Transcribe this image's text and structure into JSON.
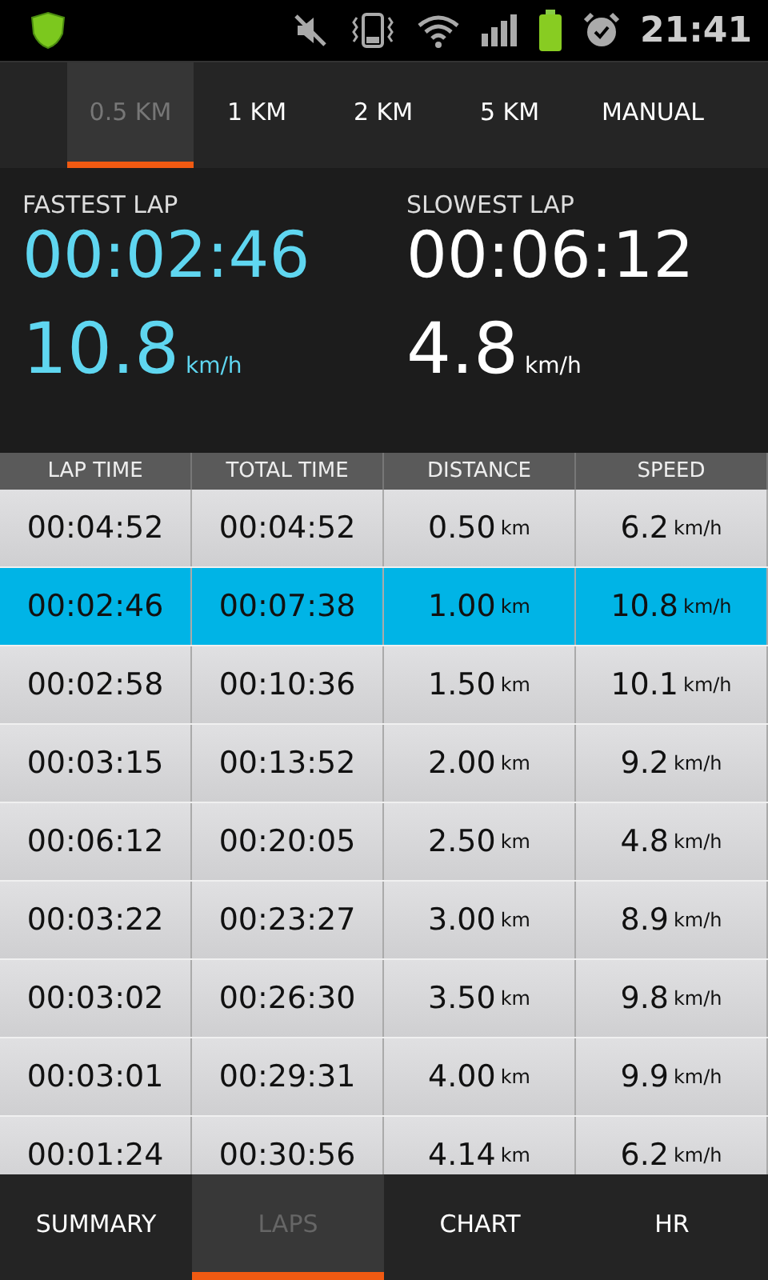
{
  "status_bar": {
    "time": "21:41"
  },
  "distance_tabs": [
    {
      "label": "0.5 KM",
      "selected": true
    },
    {
      "label": "1 KM",
      "selected": false
    },
    {
      "label": "2 KM",
      "selected": false
    },
    {
      "label": "5 KM",
      "selected": false
    },
    {
      "label": "MANUAL",
      "selected": false
    }
  ],
  "summary": [
    {
      "label": "FASTEST LAP",
      "time": "00:02:46",
      "speed": "10.8",
      "unit": "km/h",
      "kind": "fast"
    },
    {
      "label": "SLOWEST LAP",
      "time": "00:06:12",
      "speed": "4.8",
      "unit": "km/h",
      "kind": "slow"
    }
  ],
  "table": {
    "columns": [
      "LAP TIME",
      "TOTAL TIME",
      "DISTANCE",
      "SPEED"
    ],
    "rows": [
      {
        "lap_time": "00:04:52",
        "total_time": "00:04:52",
        "distance": "0.50",
        "distance_unit": "km",
        "speed": "6.2",
        "speed_unit": "km/h",
        "selected": false
      },
      {
        "lap_time": "00:02:46",
        "total_time": "00:07:38",
        "distance": "1.00",
        "distance_unit": "km",
        "speed": "10.8",
        "speed_unit": "km/h",
        "selected": true
      },
      {
        "lap_time": "00:02:58",
        "total_time": "00:10:36",
        "distance": "1.50",
        "distance_unit": "km",
        "speed": "10.1",
        "speed_unit": "km/h",
        "selected": false
      },
      {
        "lap_time": "00:03:15",
        "total_time": "00:13:52",
        "distance": "2.00",
        "distance_unit": "km",
        "speed": "9.2",
        "speed_unit": "km/h",
        "selected": false
      },
      {
        "lap_time": "00:06:12",
        "total_time": "00:20:05",
        "distance": "2.50",
        "distance_unit": "km",
        "speed": "4.8",
        "speed_unit": "km/h",
        "selected": false
      },
      {
        "lap_time": "00:03:22",
        "total_time": "00:23:27",
        "distance": "3.00",
        "distance_unit": "km",
        "speed": "8.9",
        "speed_unit": "km/h",
        "selected": false
      },
      {
        "lap_time": "00:03:02",
        "total_time": "00:26:30",
        "distance": "3.50",
        "distance_unit": "km",
        "speed": "9.8",
        "speed_unit": "km/h",
        "selected": false
      },
      {
        "lap_time": "00:03:01",
        "total_time": "00:29:31",
        "distance": "4.00",
        "distance_unit": "km",
        "speed": "9.9",
        "speed_unit": "km/h",
        "selected": false
      },
      {
        "lap_time": "00:01:24",
        "total_time": "00:30:56",
        "distance": "4.14",
        "distance_unit": "km",
        "speed": "6.2",
        "speed_unit": "km/h",
        "selected": false
      }
    ]
  },
  "bottom_tabs": [
    {
      "label": "SUMMARY",
      "selected": false
    },
    {
      "label": "LAPS",
      "selected": true
    },
    {
      "label": "CHART",
      "selected": false
    },
    {
      "label": "HR",
      "selected": false
    }
  ]
}
